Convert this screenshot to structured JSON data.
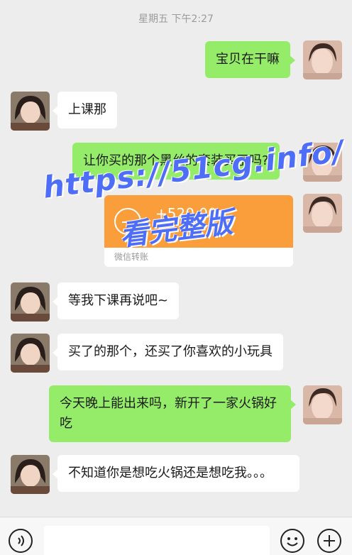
{
  "chat": {
    "timestamp": "星期五 下午2:27",
    "messages": [
      {
        "side": "me",
        "text": "宝贝在干嘛"
      },
      {
        "side": "other",
        "text": "上课那"
      },
      {
        "side": "me",
        "text": "让你买的那个黑丝的套装买了吗?"
      },
      {
        "side": "other",
        "text": "等我下课再说吧~"
      },
      {
        "side": "other",
        "text": "买了的那个，还买了你喜欢的小玩具"
      },
      {
        "side": "me",
        "text": "今天晚上能出来吗，新开了一家火锅好吃"
      },
      {
        "side": "other",
        "text": "不知道你是想吃火锅还是想吃我。。。"
      }
    ],
    "transfer": {
      "amount": "+520.00",
      "label": "微信转账"
    }
  },
  "watermark": {
    "url": "https://51cg.info/",
    "text": "看完整版"
  },
  "colors": {
    "me_bubble": "#95ec69",
    "other_bubble": "#ffffff",
    "transfer": "#fa9d3b",
    "watermark": "#4f6ef7"
  },
  "icons": {
    "voice": "voice-icon",
    "emoji": "emoji-icon",
    "plus": "plus-icon"
  }
}
